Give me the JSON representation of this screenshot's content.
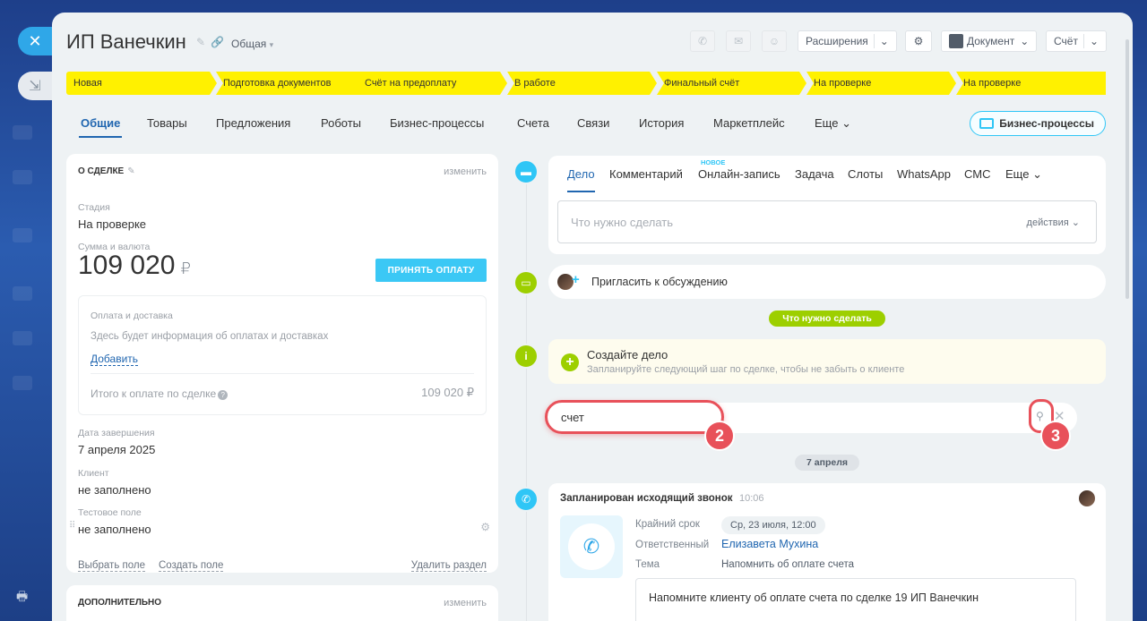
{
  "slider": {
    "title": "ИП Ванечкин",
    "category": "Общая",
    "extensions_label": "Расширения",
    "document_label": "Документ",
    "invoice_label": "Счёт"
  },
  "stages": [
    "Новая",
    "Подготовка документов",
    "Счёт на предоплату",
    "В работе",
    "Финальный счёт",
    "На проверке",
    "На проверке"
  ],
  "stage_color": "#fff100",
  "tabs": [
    "Общие",
    "Товары",
    "Предложения",
    "Роботы",
    "Бизнес-процессы",
    "Счета",
    "Связи",
    "История",
    "Маркетплейс",
    "Еще"
  ],
  "bp_button": "Бизнес-процессы",
  "deal": {
    "header": "О СДЕЛКЕ",
    "edit": "изменить",
    "stage_label": "Стадия",
    "stage_value": "На проверке",
    "sum_label": "Сумма и валюта",
    "sum_value": "109 020",
    "currency": "₽",
    "pay_button": "ПРИНЯТЬ ОПЛАТУ",
    "payment_title": "Оплата и доставка",
    "payment_info": "Здесь будет информация об оплатах и доставках",
    "payment_add": "Добавить",
    "total_label": "Итого к оплате по сделке",
    "total_value": "109 020 ₽",
    "close_date_label": "Дата завершения",
    "close_date_value": "7 апреля 2025",
    "client_label": "Клиент",
    "client_value": "не заполнено",
    "test_label": "Тестовое поле",
    "test_value": "не заполнено",
    "choose_field": "Выбрать поле",
    "create_field": "Создать поле",
    "delete_section": "Удалить раздел"
  },
  "extra": {
    "header": "ДОПОЛНИТЕЛЬНО",
    "edit": "изменить"
  },
  "editor": {
    "tabs": [
      "Дело",
      "Комментарий",
      "Онлайн-запись",
      "Задача",
      "Слоты",
      "WhatsApp",
      "СМС",
      "Еще"
    ],
    "new_badge": "НОВОЕ",
    "placeholder": "Что нужно сделать",
    "actions": "действия"
  },
  "invite_text": "Пригласить к обсуждению",
  "todo_pill": "Что нужно сделать",
  "create": {
    "title": "Создайте дело",
    "subtitle": "Запланируйте следующий шаг по сделке, чтобы не забыть о клиенте"
  },
  "search": {
    "value": "счет",
    "callout_input": "2",
    "callout_icon": "3"
  },
  "date_pill": "7 апреля",
  "call": {
    "title": "Запланирован исходящий звонок",
    "time": "10:06",
    "deadline_label": "Крайний срок",
    "deadline_value": "Ср, 23 июля, 12:00",
    "responsible_label": "Ответственный",
    "responsible_value": "Елизавета Мухина",
    "topic_label": "Тема",
    "topic_value": "Напомнить об оплате счета",
    "note": "Напомните клиенту об оплате счета по сделке 19 ИП Ванечкин"
  }
}
